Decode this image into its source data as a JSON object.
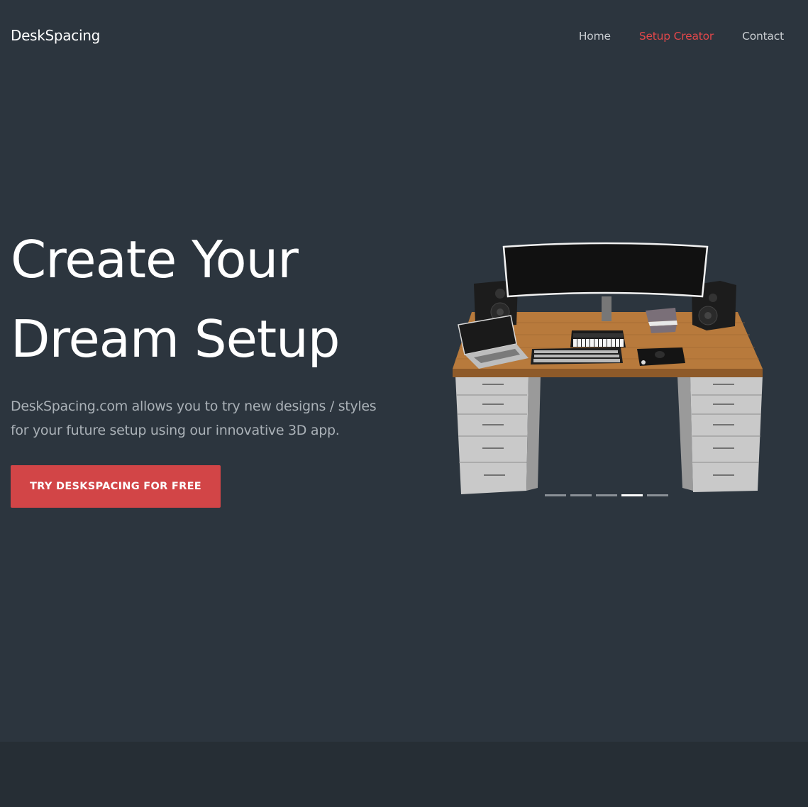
{
  "brand": "DeskSpacing",
  "nav": {
    "items": [
      {
        "label": "Home",
        "active": false
      },
      {
        "label": "Setup Creator",
        "active": true
      },
      {
        "label": "Contact",
        "active": false
      }
    ]
  },
  "hero": {
    "title_line1": "Create Your",
    "title_line2": "Dream Setup",
    "description": "DeskSpacing.com allows you to try new designs / styles for your future setup using our innovative 3D app.",
    "cta_label": "TRY DESKSPACING FOR FREE"
  },
  "carousel": {
    "slide_count": 5,
    "active_index": 3
  },
  "colors": {
    "background": "#2c353e",
    "footer": "#262e35",
    "accent": "#d24547",
    "active_nav": "#e1474a"
  }
}
